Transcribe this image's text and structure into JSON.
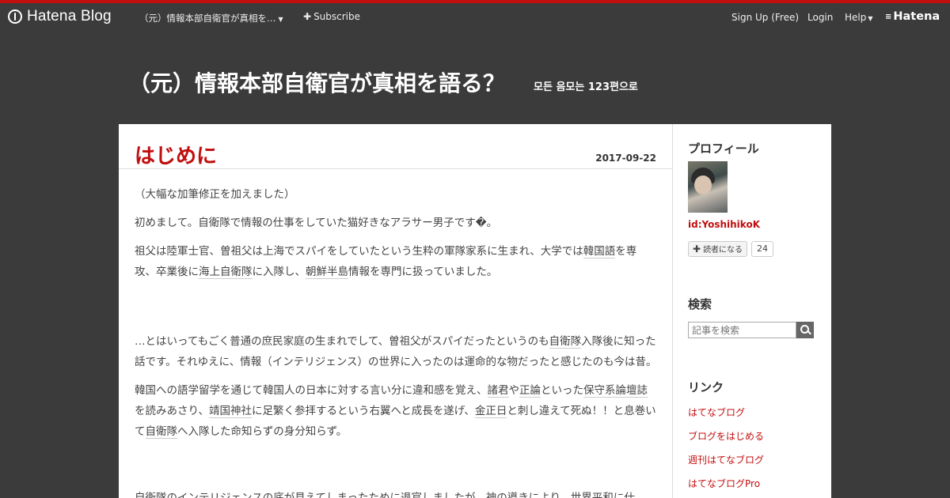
{
  "global_header": {
    "logo_text": "Hatena Blog",
    "blog_menu": "（元）情報本部自衛官が真相を…",
    "subscribe": "Subscribe",
    "signup": "Sign Up (Free)",
    "login": "Login",
    "help": "Help",
    "hatena": "Hatena"
  },
  "blog": {
    "title": "（元）情報本部自衛官が真相を語る？",
    "description": "모든 음모는 123편으로"
  },
  "entry": {
    "title": "はじめに",
    "date": "2017-09-22",
    "p1": "（大幅な加筆修正を加えました）",
    "p2": "初めまして。自衛隊で情報の仕事をしていた猫好きなアラサー男子です�。",
    "p3_a": "祖父は陸軍士官、曽祖父は上海でスパイをしていたという生粋の軍隊家系に生まれ、大学では",
    "p3_k1": "韓国語",
    "p3_b": "を専攻、卒業後に",
    "p3_k2": "海上自衛隊",
    "p3_c": "に入隊し、",
    "p3_k3": "朝鮮半島",
    "p3_d": "情報を専門に扱っていました。",
    "p4_a": "…とはいってもごく普通の庶民家庭の生まれでして、曽祖父がスパイだったというのも",
    "p4_k1": "自衛隊",
    "p4_b": "入隊後に知った話です。それゆえに、情報（インテリジェンス）の世界に入ったのは運命的な物だったと感じたのも今は昔。",
    "p5_a": "韓国への語学留学を通じて韓国人の日本に対する言い分に違和感を覚え、",
    "p5_k1": "諸君",
    "p5_b": "や",
    "p5_k2": "正論",
    "p5_c": "といった",
    "p5_k3": "保守系論壇誌",
    "p5_d": "を読みあさり、",
    "p5_k4": "靖国神社",
    "p5_e": "に足繁く参拝するという右翼へと成長を遂げ、",
    "p5_k5": "金正日",
    "p5_f": "と刺し違えて死ぬ！！と息巻いて",
    "p5_k6": "自衛隊",
    "p5_g": "へ入隊した命知らずの身分知らず。",
    "p6_k1": "自衛隊",
    "p6_a": "のインテリジェンスの底が見えてしまったために退官しましたが、神の導きにより、世界平和に仕"
  },
  "sidebar": {
    "profile_title": "プロフィール",
    "user_id": "id:YoshihikoK",
    "reader_button": "読者になる",
    "reader_count": "24",
    "search_title": "検索",
    "search_placeholder": "記事を検索",
    "links_title": "リンク",
    "links": [
      "はてなブログ",
      "ブログをはじめる",
      "週刊はてなブログ",
      "はてなブログPro"
    ]
  },
  "colors": {
    "accent": "#c10e0e",
    "header_bg": "#3b3b3b"
  },
  "icons": [
    "hatena-blog-logo-icon",
    "plus-icon",
    "chevron-down-icon",
    "search-icon",
    "hatena-logo-icon"
  ]
}
